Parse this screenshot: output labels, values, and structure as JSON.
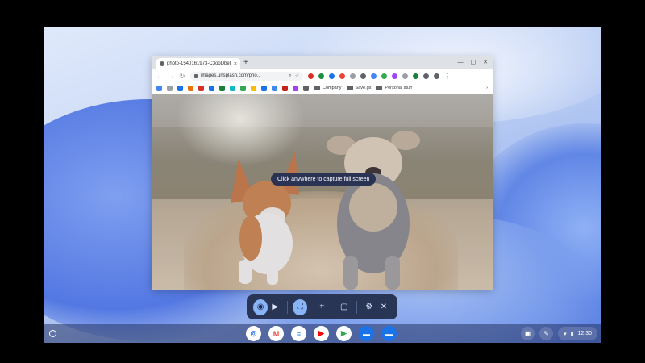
{
  "browser": {
    "tab_title": "photo-1540161973-C3ooDbetC",
    "tab_close": "×",
    "new_tab": "+",
    "window_controls": [
      "—",
      "▢",
      "✕"
    ],
    "url": "images.unsplash.com/pho...",
    "nav": {
      "back": "←",
      "forward": "→",
      "reload": "↻"
    },
    "bookmark_folders": [
      "Company",
      "Save.gs",
      "Personal stuff"
    ],
    "bookmark_more": "›"
  },
  "capture": {
    "tooltip": "Click anywhere to capture full screen",
    "buttons": [
      {
        "icon": "camera-icon",
        "glyph": "◉"
      },
      {
        "icon": "video-icon",
        "glyph": "▶"
      },
      {
        "icon": "fullscreen-capture-icon",
        "glyph": "⛶"
      },
      {
        "icon": "partial-capture-icon",
        "glyph": "⌗"
      },
      {
        "icon": "window-capture-icon",
        "glyph": "▢"
      },
      {
        "icon": "settings-icon",
        "glyph": "⚙"
      },
      {
        "icon": "close-icon",
        "glyph": "✕"
      }
    ]
  },
  "shelf": {
    "apps": [
      {
        "name": "chrome",
        "glyph": "◎",
        "color": "#4285f4"
      },
      {
        "name": "gmail",
        "glyph": "M",
        "color": "#ea4335"
      },
      {
        "name": "docs",
        "glyph": "≡",
        "color": "#4285f4"
      },
      {
        "name": "youtube",
        "glyph": "▶",
        "color": "#ff0000"
      },
      {
        "name": "play-store",
        "glyph": "▶",
        "color": "#34a853"
      },
      {
        "name": "files",
        "glyph": "▬",
        "color": "#1a73e8"
      },
      {
        "name": "messages",
        "glyph": "▬",
        "color": "#1a73e8"
      }
    ],
    "time": "12:30",
    "wifi": "▾",
    "battery": "▮"
  }
}
